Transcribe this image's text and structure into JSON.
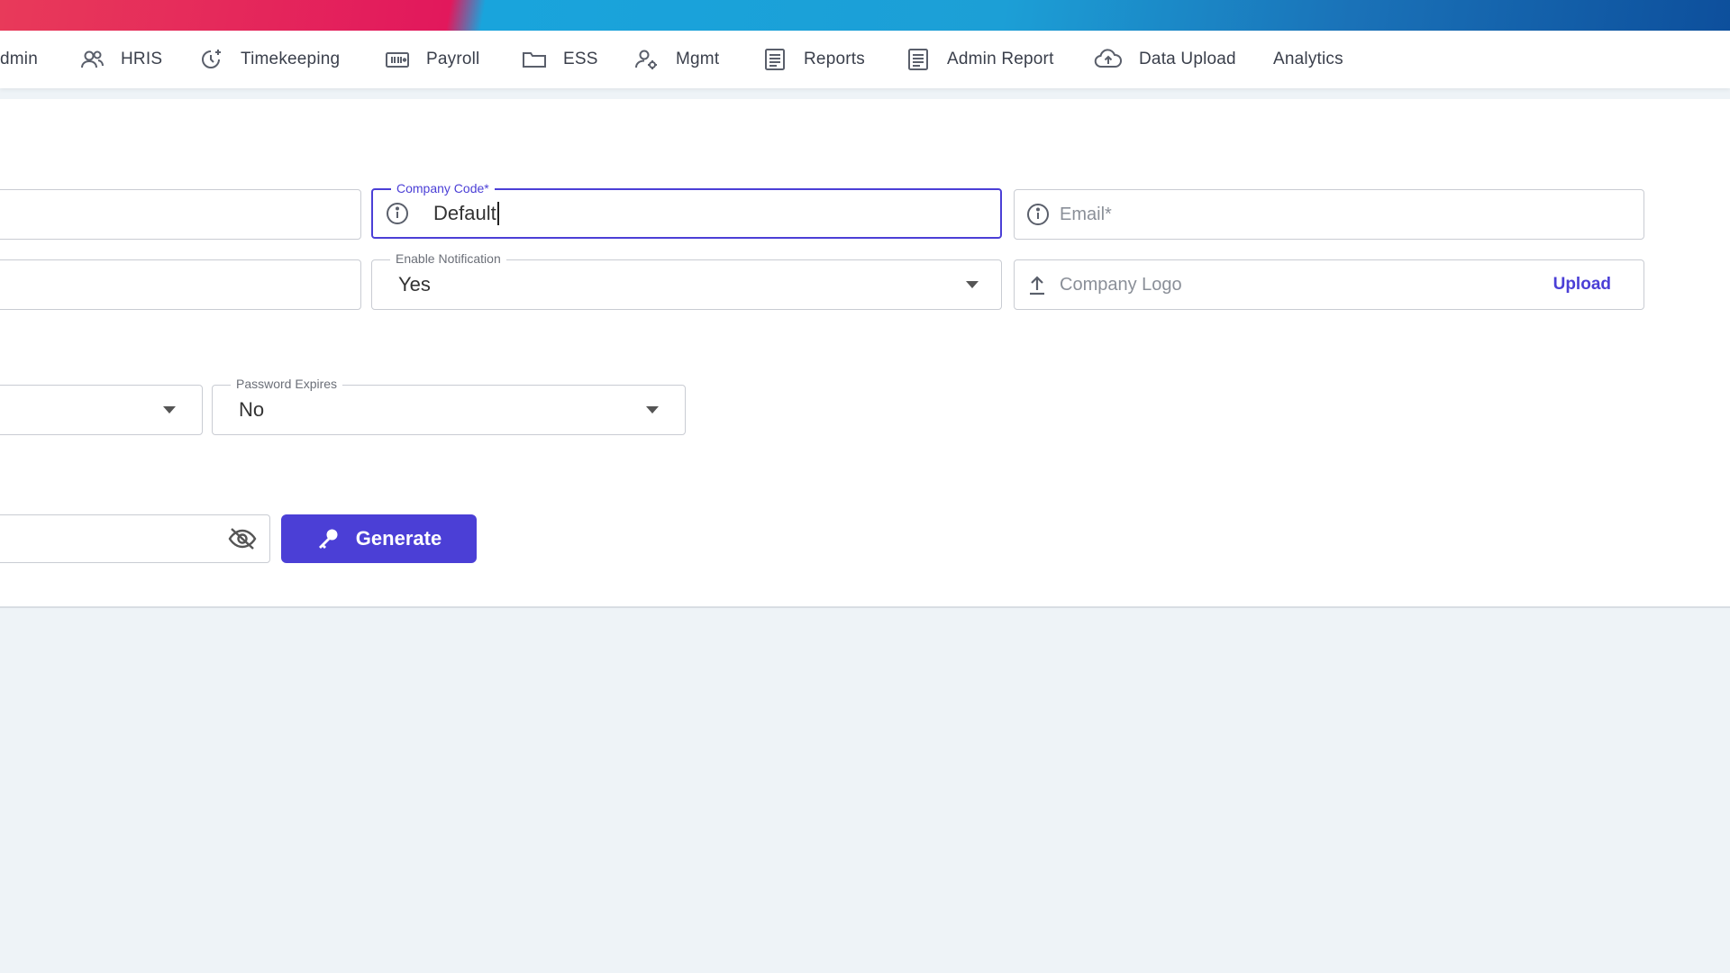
{
  "nav": {
    "items": [
      {
        "label": "dmin",
        "icon": "none"
      },
      {
        "label": "HRIS",
        "icon": "users-icon"
      },
      {
        "label": "Timekeeping",
        "icon": "clock-add-icon"
      },
      {
        "label": "Payroll",
        "icon": "payroll-icon"
      },
      {
        "label": "ESS",
        "icon": "folder-icon"
      },
      {
        "label": "Mgmt",
        "icon": "user-gear-icon"
      },
      {
        "label": "Reports",
        "icon": "document-icon"
      },
      {
        "label": "Admin Report",
        "icon": "document-icon"
      },
      {
        "label": "Data Upload",
        "icon": "cloud-upload-icon"
      },
      {
        "label": "Analytics",
        "icon": "none"
      }
    ]
  },
  "form": {
    "company_code": {
      "label": "Company Code*",
      "value": "Default"
    },
    "email": {
      "placeholder": "Email*"
    },
    "enable_notification": {
      "label": "Enable Notification",
      "value": "Yes"
    },
    "company_logo": {
      "placeholder": "Company Logo",
      "action": "Upload"
    },
    "password_expires": {
      "label": "Password Expires",
      "value": "No"
    },
    "generate_label": "Generate"
  },
  "colors": {
    "accent": "#4b3fd6",
    "background": "#eef3f7",
    "nav_text": "#3a3f4b"
  }
}
